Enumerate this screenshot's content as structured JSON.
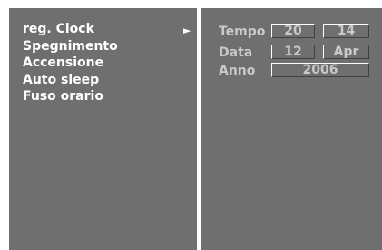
{
  "menu": {
    "items": [
      {
        "label": "reg. Clock",
        "selected": true
      },
      {
        "label": "Spegnimento"
      },
      {
        "label": "Accensione"
      },
      {
        "label": "Auto sleep"
      },
      {
        "label": "Fuso orario"
      }
    ],
    "submenu_indicator": "►"
  },
  "clock": {
    "time_label": "Tempo",
    "hour": "20",
    "minute": "14",
    "date_label": "Data",
    "day": "12",
    "month": "Apr",
    "year_label": "Anno",
    "year": "2006"
  },
  "colors": {
    "panel_bg": "#6f6f6f",
    "text_primary": "#ffffff",
    "text_secondary": "#c9c9c9"
  }
}
